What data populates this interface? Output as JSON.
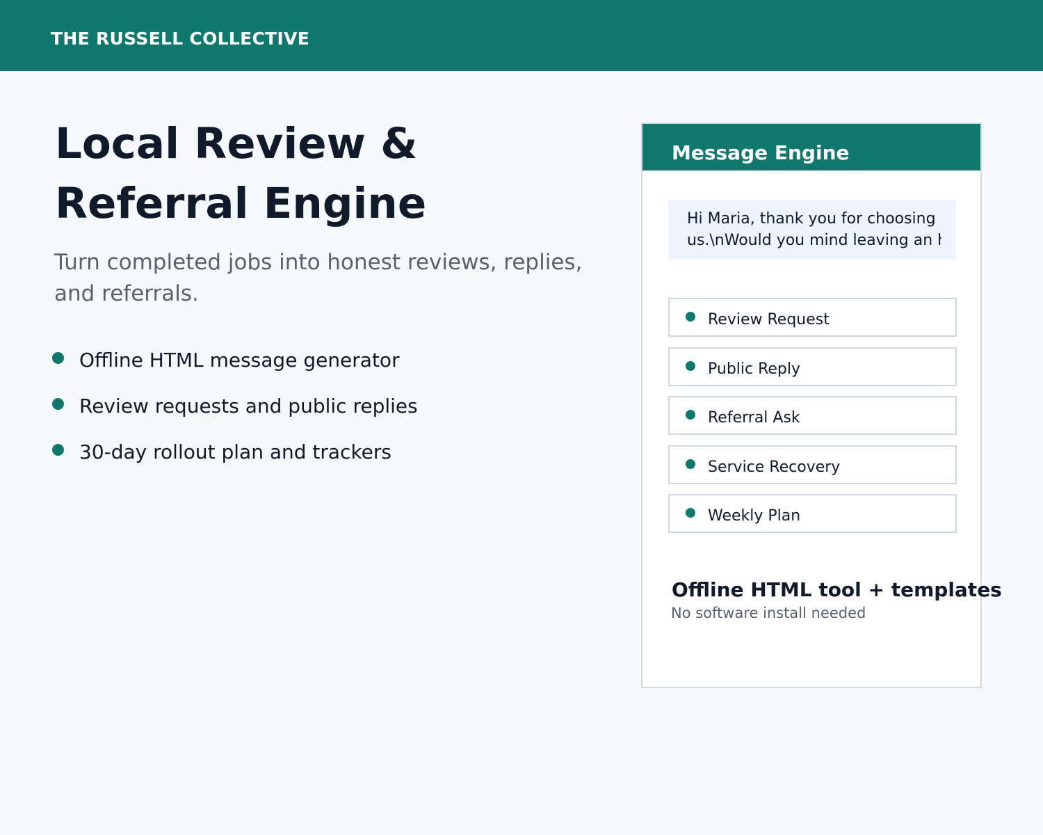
{
  "colors": {
    "brand": "#10786c",
    "background": "#f5f9fc",
    "text": "#111a2b",
    "muted": "#59616e",
    "preview_bg": "#edf4fd",
    "border": "#cfd7e2"
  },
  "header": {
    "brand": "THE RUSSELL COLLECTIVE"
  },
  "hero": {
    "title": "Local Review & Referral Engine",
    "subtitle": "Turn completed jobs into honest reviews, replies, and referrals.",
    "features": [
      "Offline HTML message generator",
      "Review requests and public replies",
      "30-day rollout plan and trackers"
    ]
  },
  "panel": {
    "title": "Message Engine",
    "message_preview": {
      "line1": "Hi Maria, thank you for choosing",
      "line2": "us.\\nWould you mind leaving an h"
    },
    "templates": [
      "Review Request",
      "Public Reply",
      "Referral Ask",
      "Service Recovery",
      "Weekly Plan"
    ],
    "footer_title": "Offline HTML tool + templates",
    "footer_subtitle": "No software install needed"
  }
}
